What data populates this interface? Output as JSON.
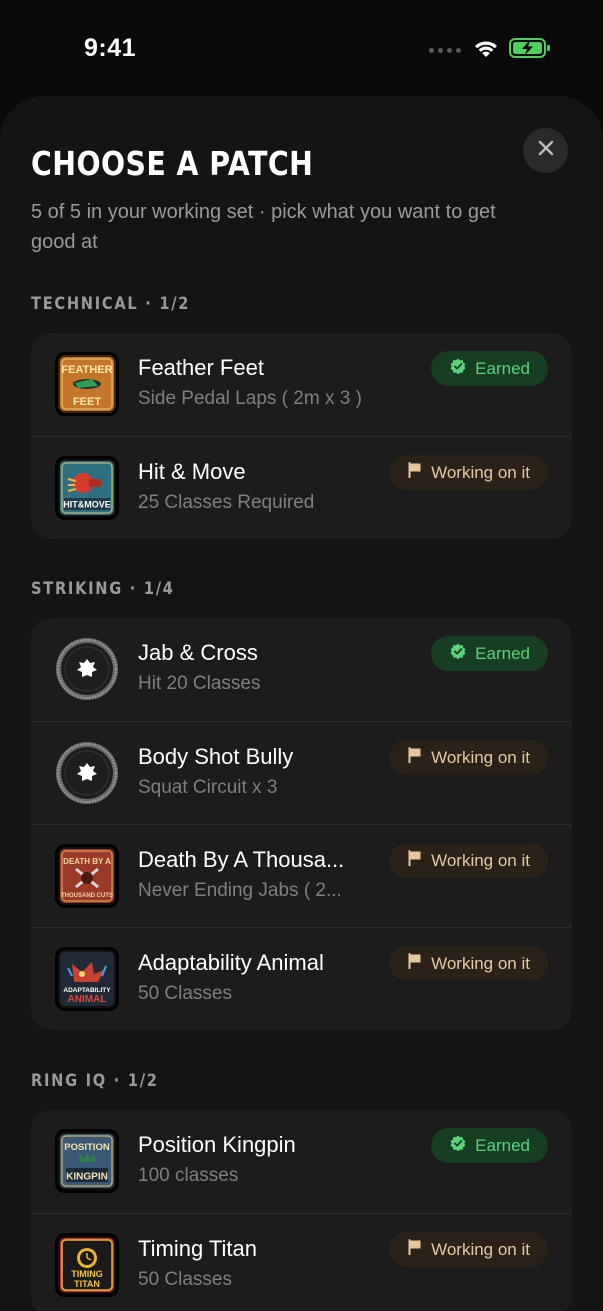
{
  "status_bar": {
    "time": "9:41"
  },
  "sheet": {
    "title": "CHOOSE A PATCH",
    "subtitle": "5 of 5 in your working set · pick what you want to get good at"
  },
  "colors": {
    "background": "#0a0a0a",
    "sheet": "#141414",
    "card": "#1c1c1c",
    "earned_text": "#5cd27a",
    "earned_bg": "#173d22",
    "working_text": "#e6c8a0",
    "working_bg": "#2a2219"
  },
  "sections": [
    {
      "header": "TECHNICAL · 1/2",
      "items": [
        {
          "name": "Feather Feet",
          "subtitle": "Side Pedal Laps ( 2m x 3 )",
          "status": "Earned",
          "status_icon": "verified-check-icon",
          "patch_icon": "feather-feet-patch-icon"
        },
        {
          "name": "Hit & Move",
          "subtitle": "25 Classes Required",
          "status": "Working on it",
          "status_icon": "flag-icon",
          "patch_icon": "hit-and-move-patch-icon"
        }
      ]
    },
    {
      "header": "STRIKING · 1/4",
      "items": [
        {
          "name": "Jab & Cross",
          "subtitle": "Hit 20 Classes",
          "status": "Earned",
          "status_icon": "verified-check-icon",
          "patch_icon": "round-placeholder-patch-icon"
        },
        {
          "name": "Body Shot Bully",
          "subtitle": "Squat Circuit x 3",
          "status": "Working on it",
          "status_icon": "flag-icon",
          "patch_icon": "round-placeholder-patch-icon"
        },
        {
          "name": "Death By A Thousa...",
          "subtitle": "Never Ending Jabs ( 2...",
          "status": "Working on it",
          "status_icon": "flag-icon",
          "patch_icon": "death-by-a-thousand-cuts-patch-icon"
        },
        {
          "name": "Adaptability Animal",
          "subtitle": "50 Classes",
          "status": "Working on it",
          "status_icon": "flag-icon",
          "patch_icon": "adaptability-animal-patch-icon"
        }
      ]
    },
    {
      "header": "RING IQ · 1/2",
      "items": [
        {
          "name": "Position Kingpin",
          "subtitle": "100 classes",
          "status": "Earned",
          "status_icon": "verified-check-icon",
          "patch_icon": "position-kingpin-patch-icon"
        },
        {
          "name": "Timing Titan",
          "subtitle": "50 Classes",
          "status": "Working on it",
          "status_icon": "flag-icon",
          "patch_icon": "timing-titan-patch-icon"
        }
      ]
    }
  ],
  "patch_art": {
    "feather_feet": [
      "FEATHER",
      "FEET"
    ],
    "hit_and_move": "HIT&MOVE",
    "death": [
      "DEATH BY A",
      "THOUSAND CUTS"
    ],
    "adaptability": [
      "ADAPTABILITY",
      "ANIMAL"
    ],
    "position": [
      "POSITION",
      "KINGPIN"
    ],
    "timing": [
      "TIMING",
      "TITAN"
    ]
  }
}
